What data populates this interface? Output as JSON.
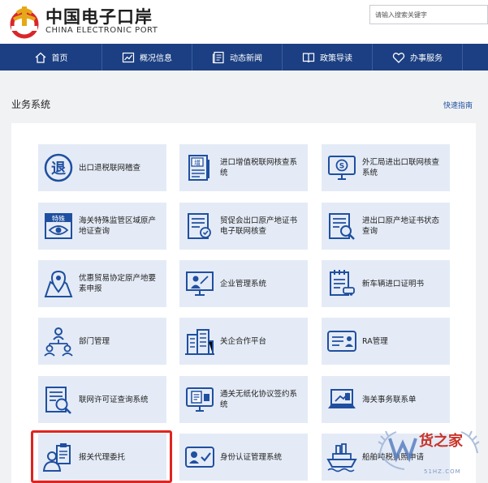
{
  "header": {
    "logo_cn": "中国电子口岸",
    "logo_en": "CHINA ELECTRONIC PORT",
    "search_placeholder": "请输入搜索关键字"
  },
  "nav": {
    "items": [
      {
        "label": "首页",
        "icon": "home-icon"
      },
      {
        "label": "概况信息",
        "icon": "chart-icon"
      },
      {
        "label": "动态新闻",
        "icon": "news-icon"
      },
      {
        "label": "政策导读",
        "icon": "book-icon"
      },
      {
        "label": "办事服务",
        "icon": "heart-icon"
      }
    ]
  },
  "section": {
    "title": "业务系统",
    "quick_link": "快速指南"
  },
  "cards": [
    {
      "label": "出口退税联网稽查",
      "icon": "refund-icon"
    },
    {
      "label": "进口增值税联网核查系统",
      "icon": "vat-document-icon"
    },
    {
      "label": "外汇局进出口联网核查系统",
      "icon": "forex-monitor-icon"
    },
    {
      "label": "海关特殊监管区域原产地证查询",
      "icon": "special-zone-eye-icon"
    },
    {
      "label": "贸促会出口原产地证书电子联网核查",
      "icon": "certificate-check-icon"
    },
    {
      "label": "进出口原产地证书状态查询",
      "icon": "certificate-search-icon"
    },
    {
      "label": "优惠贸易协定原产地要素申报",
      "icon": "map-pin-icon"
    },
    {
      "label": "企业管理系统",
      "icon": "enterprise-presentation-icon"
    },
    {
      "label": "新车辆进口证明书",
      "icon": "vehicle-document-icon"
    },
    {
      "label": "部门管理",
      "icon": "org-chart-icon"
    },
    {
      "label": "关企合作平台",
      "icon": "building-icon"
    },
    {
      "label": "RA管理",
      "icon": "id-card-icon"
    },
    {
      "label": "联网许可证查询系统",
      "icon": "license-search-icon"
    },
    {
      "label": "通关无纸化协议签约系统",
      "icon": "paperless-monitor-icon"
    },
    {
      "label": "海关事务联系单",
      "icon": "laptop-contact-icon"
    },
    {
      "label": "报关代理委托",
      "icon": "agent-clipboard-icon"
    },
    {
      "label": "身份认证管理系统",
      "icon": "identity-check-icon"
    },
    {
      "label": "船舶吨税执照申请",
      "icon": "ship-icon"
    }
  ],
  "watermark": {
    "text": "货之家",
    "sub": "51HZ.COM"
  },
  "colors": {
    "nav_bg": "#1b3f82",
    "card_bg": "#e4ebf6",
    "icon": "#1f4fa0",
    "highlight": "#e0241f"
  }
}
